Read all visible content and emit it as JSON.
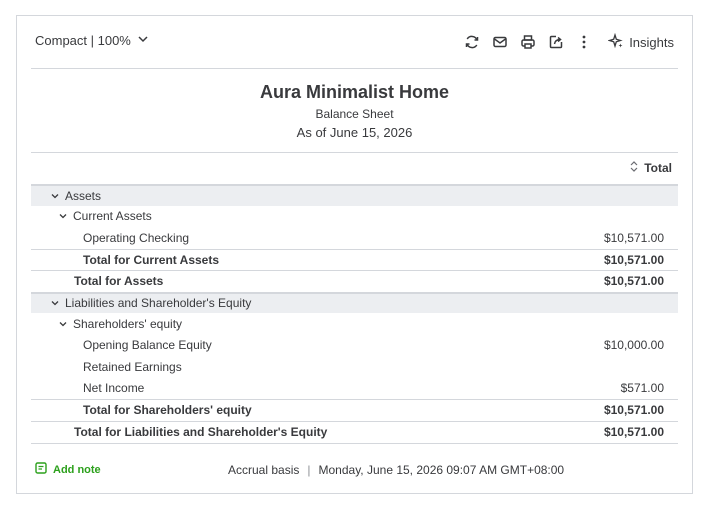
{
  "toolbar": {
    "view_label": "Compact | 100%",
    "insights_label": "Insights",
    "icons": [
      "refresh-icon",
      "email-icon",
      "print-icon",
      "export-icon",
      "more-icon",
      "sparkle-icon"
    ]
  },
  "report": {
    "company": "Aura Minimalist Home",
    "title": "Balance Sheet",
    "as_of": "As of June 15, 2026",
    "column_header": "Total"
  },
  "rows": [
    {
      "label": "Assets",
      "amount": ""
    },
    {
      "label": "Current Assets",
      "amount": ""
    },
    {
      "label": "Operating Checking",
      "amount": "$10,571.00"
    },
    {
      "label": "Total for Current Assets",
      "amount": "$10,571.00"
    },
    {
      "label": "Total for Assets",
      "amount": "$10,571.00"
    },
    {
      "label": "Liabilities and Shareholder's Equity",
      "amount": ""
    },
    {
      "label": "Shareholders' equity",
      "amount": ""
    },
    {
      "label": "Opening Balance Equity",
      "amount": "$10,000.00"
    },
    {
      "label": "Retained Earnings",
      "amount": ""
    },
    {
      "label": "Net Income",
      "amount": "$571.00"
    },
    {
      "label": "Total for Shareholders' equity",
      "amount": "$10,571.00"
    },
    {
      "label": "Total for Liabilities and Shareholder's Equity",
      "amount": "$10,571.00"
    }
  ],
  "footer": {
    "add_note": "Add note",
    "basis": "Accrual basis",
    "timestamp": "Monday, June 15, 2026 09:07 AM GMT+08:00"
  },
  "colors": {
    "accent": "#2ca01c",
    "section_bg": "#eceef1",
    "text": "#393a3d"
  }
}
